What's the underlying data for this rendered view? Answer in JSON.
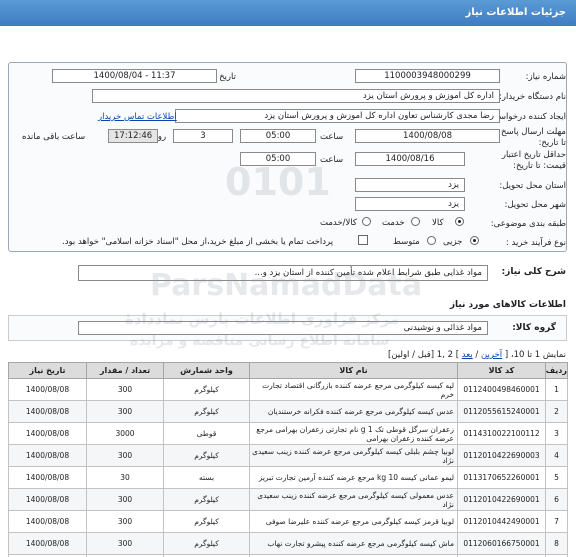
{
  "header": {
    "title": "جزئیات اطلاعات نیاز"
  },
  "form": {
    "need_number_label": "شماره نیاز:",
    "need_number": "1100003948000299",
    "announce_label": "تاریخ و ساعت اعلان عمومی:",
    "announce_value": "1400/08/04 - 11:37",
    "buyer_org_label": "نام دستگاه خریدار:",
    "buyer_org": "اداره کل اموزش و پرورش استان یزد",
    "creator_label": "ایجاد کننده درخواست:",
    "creator": "رضا مجدی کارشناس تعاون اداره کل اموزش و پرورش استان یزد",
    "buyer_contact_link": "اطلاعات تماس خریدار",
    "send_deadline_label": "مهلت ارسال پاسخ: تا تاریخ:",
    "send_date": "1400/08/08",
    "time_label": "ساعت",
    "send_time": "05:00",
    "days_value": "3",
    "days_label": "روز و",
    "remaining_time": "17:12:46",
    "remaining_label": "ساعت باقی مانده",
    "price_validity_label": "حداقل تاریخ اعتبار قیمت: تا تاریخ:",
    "validity_date": "1400/08/16",
    "validity_time_label": "ساعت",
    "validity_time": "05:00",
    "province_label": "استان محل تحویل:",
    "province": "یزد",
    "city_label": "شهر محل تحویل:",
    "city": "یزد",
    "category_label": "طبقه بندی موضوعی:",
    "category_options": [
      "کالا",
      "خدمت",
      "کالا/خدمت"
    ],
    "process_label": "نوع فرآیند خرید :",
    "process_options": [
      "جزیی",
      "متوسط"
    ],
    "payment_note": "پرداخت تمام یا بخشی از مبلغ خرید،از محل \"اسناد خزانه اسلامی\" خواهد بود."
  },
  "need_description": {
    "label": "شرح کلی نیاز:",
    "value": "مواد غذایی طبق شرایط اعلام شده تأمین کننده از استان یزد و..."
  },
  "goods": {
    "section_title": "اطلاعات کالاهای مورد نیاز",
    "group_label": "گروه کالا:",
    "group_value": "مواد غذائی و نوشیدنی",
    "paging_prefix": "نمایش 1 تا 10،  [",
    "paging_last": "آخرین",
    "paging_next": "بعد",
    "paging_pages": "] 2 ,1",
    "paging_suffix": "[قبل / اولین]",
    "columns": [
      "ردیف",
      "کد کالا",
      "نام کالا",
      "واحد شمارش",
      "تعداد / مقدار",
      "تاریخ نیاز"
    ],
    "rows": [
      [
        "1",
        "0112400498460001",
        "لپه کیسه کیلوگرمی مرجع عرضه کننده بازرگانی اقتصاد تجارت خرم",
        "کیلوگرم",
        "300",
        "1400/08/08"
      ],
      [
        "2",
        "0112055615240001",
        "عدس کیسه کیلوگرمی مرجع عرضه کننده فکرانه خرستندیان",
        "کیلوگرم",
        "300",
        "1400/08/08"
      ],
      [
        "3",
        "0114310022100112",
        "زعفران سرگل قوطی تک g 1 نام تجارتی زعفران بهرامی مرجع عرضه کننده زعفران بهرامی",
        "قوطی",
        "3000",
        "1400/08/08"
      ],
      [
        "4",
        "0112010422690003",
        "لوبیا چشم بلبلی کیسه کیلوگرمی مرجع عرضه کننده زینب سعیدی نژاد",
        "کیلوگرم",
        "300",
        "1400/08/08"
      ],
      [
        "5",
        "0113170652260001",
        "لیمو عمانی کیسه kg 10 مرجع عرضه کننده آرمین تجارت تبریز",
        "بسته",
        "30",
        "1400/08/08"
      ],
      [
        "6",
        "0112010422690001",
        "عدس معمولی کیسه کیلوگرمی مرجع عرضه کننده زینب سعیدی نژاد",
        "کیلوگرم",
        "300",
        "1400/08/08"
      ],
      [
        "7",
        "0112010442490001",
        "لوبیا قرمز کیسه کیلوگرمی مرجع عرضه کننده علیرضا صوفی",
        "کیلوگرم",
        "300",
        "1400/08/08"
      ],
      [
        "8",
        "0112060166750001",
        "ماش کیسه کیلوگرمی مرجع عرضه کننده پیشرو تجارت نهاب",
        "کیلوگرم",
        "300",
        "1400/08/08"
      ],
      [
        "9",
        "0112010422690002",
        "نخود خام کیسه کیلوگرمی مرجع عرضه کننده ادهم بیجاد",
        "کیلوگرم",
        "300",
        "1400/08/08"
      ]
    ]
  },
  "watermark": {
    "main": "ParsNamadData",
    "sub": "مرکز فراوری اطلاعات پارس نماددادهٔ",
    "sub2": "سامانه اطلاع رسانی مناقصه و مزایده",
    "numbers": "0101"
  },
  "colors": {
    "header_bg": "#4a8bcb",
    "link": "#0645ad",
    "table_header": "#dcdcdc"
  }
}
